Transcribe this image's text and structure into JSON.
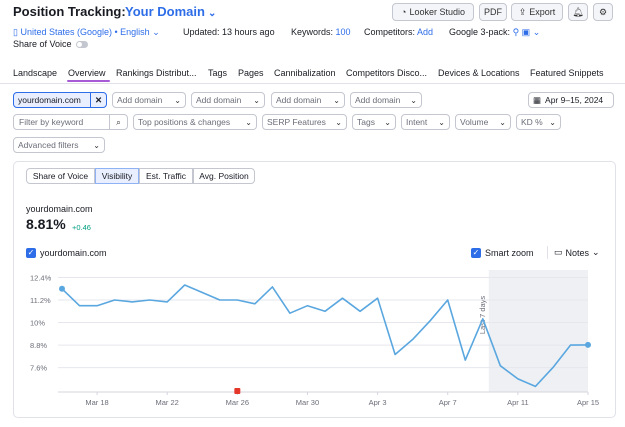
{
  "header": {
    "title": "Position Tracking:",
    "domain": "Your Domain",
    "buttons": {
      "looker": "Looker Studio",
      "pdf": "PDF",
      "export": "Export"
    }
  },
  "meta": {
    "location": "United States (Google) • English",
    "updated": "Updated: 13 hours ago",
    "keywords_label": "Keywords:",
    "keywords_value": "100",
    "competitors_label": "Competitors:",
    "competitors_value": "Add",
    "google3pack": "Google 3-pack:"
  },
  "share_of_voice_toggle": "Share of Voice",
  "tabs": [
    "Landscape",
    "Overview",
    "Rankings Distribut...",
    "Tags",
    "Pages",
    "Cannibalization",
    "Competitors Disco...",
    "Devices & Locations",
    "Featured Snippets"
  ],
  "filters": {
    "domain": "yourdomain.com",
    "add_domain": "Add domain",
    "date_range": "Apr 9–15, 2024",
    "keyword_placeholder": "Filter by keyword",
    "dropdowns": [
      "Top positions & changes",
      "SERP Features",
      "Tags",
      "Intent",
      "Volume",
      "KD %"
    ],
    "advanced": "Advanced filters"
  },
  "chart_tabs": [
    "Share of Voice",
    "Visibility",
    "Est. Traffic",
    "Avg. Position"
  ],
  "summary": {
    "site": "yourdomain.com",
    "value": "8.81%",
    "delta": "+0.46"
  },
  "legend": {
    "series": "yourdomain.com",
    "smart_zoom": "Smart zoom",
    "notes": "Notes"
  },
  "colors": {
    "accent": "#2d6de8",
    "line": "#5aa7e0",
    "tab_underline": "#a75cd6",
    "positive": "#009f81",
    "marker": "#e5362a"
  },
  "chart_data": {
    "type": "line",
    "title": "",
    "xlabel": "",
    "ylabel": "",
    "yticks": [
      "12.4%",
      "11.2%",
      "10%",
      "8.8%",
      "7.6%"
    ],
    "ytick_values": [
      12.4,
      11.2,
      10.0,
      8.8,
      7.6
    ],
    "ylim": [
      6.3,
      12.8
    ],
    "xticks": [
      "Mar 18",
      "Mar 22",
      "Mar 26",
      "Mar 30",
      "Apr 3",
      "Apr 7",
      "Apr 11",
      "Apr 15"
    ],
    "x": [
      "2024-03-16",
      "2024-03-17",
      "2024-03-18",
      "2024-03-19",
      "2024-03-20",
      "2024-03-21",
      "2024-03-22",
      "2024-03-23",
      "2024-03-24",
      "2024-03-25",
      "2024-03-26",
      "2024-03-27",
      "2024-03-28",
      "2024-03-29",
      "2024-03-30",
      "2024-03-31",
      "2024-04-01",
      "2024-04-02",
      "2024-04-03",
      "2024-04-04",
      "2024-04-05",
      "2024-04-06",
      "2024-04-07",
      "2024-04-08",
      "2024-04-09",
      "2024-04-10",
      "2024-04-11",
      "2024-04-12",
      "2024-04-13",
      "2024-04-14",
      "2024-04-15"
    ],
    "series": [
      {
        "name": "yourdomain.com",
        "values": [
          11.8,
          10.9,
          10.9,
          11.2,
          11.1,
          11.2,
          11.1,
          12.0,
          11.6,
          11.2,
          11.2,
          11.0,
          11.9,
          10.5,
          10.9,
          10.6,
          11.3,
          10.6,
          11.3,
          8.3,
          9.1,
          10.1,
          11.2,
          8.0,
          10.2,
          7.7,
          7.0,
          6.6,
          7.6,
          8.8,
          8.81
        ]
      }
    ],
    "highlight_label": "Last 7 days",
    "highlight_range": [
      "2024-04-09",
      "2024-04-15"
    ],
    "note_marker": "2024-03-26",
    "grid": "horizontal",
    "legend": "top-left"
  }
}
